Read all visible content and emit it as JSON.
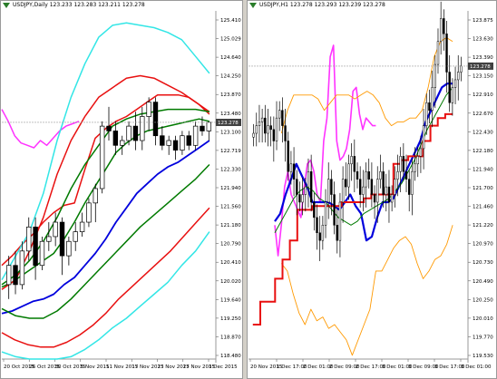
{
  "left_chart": {
    "title": "USDJPY,Daily  123.233 123.283 123.211 123.278",
    "price_label": "123.278",
    "y_ticks": [
      "125.410",
      "125.029",
      "124.640",
      "124.250",
      "123.870",
      "123.480",
      "123.100",
      "122.719",
      "122.330",
      "121.940",
      "121.560",
      "121.180",
      "120.790",
      "120.410",
      "120.020",
      "119.640",
      "119.250",
      "118.870",
      "118.480"
    ],
    "x_ticks": [
      "20 Oct 2015",
      "26 Oct 2015",
      "30 Oct 2015",
      "5 Nov 2015",
      "11 Nov 2015",
      "17 Nov 2015",
      "23 Nov 2015",
      "27 Nov 2015",
      "3 Dec 2015"
    ],
    "colors": {
      "candle": "#000000",
      "magenta": "#ff33ff",
      "red": "#e81010",
      "green": "#007a00",
      "blue": "#0000dd",
      "cyan": "#33e6e6",
      "gridline": "#c0c0c0"
    },
    "chart_data": {
      "type": "candlestick",
      "ylim": [
        118.35,
        125.6
      ],
      "candles": [
        [
          119.9,
          120.5,
          119.6,
          120.3
        ],
        [
          120.3,
          120.6,
          119.7,
          119.9
        ],
        [
          119.9,
          120.8,
          119.8,
          120.6
        ],
        [
          120.6,
          121.3,
          120.4,
          121.1
        ],
        [
          121.1,
          121.3,
          120.0,
          120.3
        ],
        [
          120.3,
          120.9,
          120.2,
          120.8
        ],
        [
          120.8,
          121.2,
          120.6,
          120.9
        ],
        [
          120.9,
          121.4,
          120.7,
          121.2
        ],
        [
          121.2,
          121.3,
          120.1,
          120.5
        ],
        [
          120.5,
          120.9,
          120.3,
          120.8
        ],
        [
          120.8,
          121.2,
          120.6,
          121.0
        ],
        [
          121.0,
          121.4,
          120.9,
          121.2
        ],
        [
          121.2,
          121.7,
          121.1,
          121.6
        ],
        [
          121.6,
          122.0,
          121.2,
          121.9
        ],
        [
          121.9,
          123.3,
          121.8,
          123.2
        ],
        [
          123.2,
          123.6,
          122.9,
          123.1
        ],
        [
          123.1,
          123.3,
          122.6,
          122.8
        ],
        [
          122.8,
          123.0,
          122.6,
          122.9
        ],
        [
          122.9,
          123.3,
          122.8,
          123.2
        ],
        [
          123.2,
          123.5,
          122.7,
          122.9
        ],
        [
          122.9,
          123.6,
          122.7,
          123.4
        ],
        [
          123.4,
          123.8,
          123.1,
          123.7
        ],
        [
          123.7,
          123.8,
          122.8,
          123.0
        ],
        [
          123.0,
          123.2,
          122.7,
          122.8
        ],
        [
          122.8,
          123.0,
          122.6,
          122.9
        ],
        [
          122.9,
          123.0,
          122.5,
          122.7
        ],
        [
          122.7,
          123.1,
          122.6,
          123.0
        ],
        [
          123.0,
          123.1,
          122.7,
          122.8
        ],
        [
          122.8,
          123.3,
          122.7,
          123.2
        ],
        [
          123.2,
          123.4,
          123.0,
          123.1
        ],
        [
          123.1,
          123.3,
          122.9,
          123.28
        ]
      ],
      "series": {
        "magenta": [
          123.55,
          123.3,
          123.0,
          122.85,
          122.8,
          122.75,
          122.9,
          122.8,
          122.95,
          123.1,
          123.2,
          123.25,
          123.3
        ],
        "red_mid": [
          120.3,
          120.5,
          120.75,
          120.95,
          121.2,
          121.4,
          121.55,
          121.6,
          122.3,
          122.95,
          123.15,
          123.3,
          123.4,
          123.55,
          123.7,
          123.85,
          123.85,
          123.85,
          123.8,
          123.65,
          123.45
        ],
        "green_mid": [
          119.85,
          119.95,
          120.1,
          120.25,
          120.4,
          120.55,
          120.85,
          121.2,
          121.6,
          121.95,
          122.3,
          122.65,
          122.85,
          123.0,
          123.1,
          123.15,
          123.2,
          123.25,
          123.3,
          123.35,
          123.3
        ],
        "blue": [
          119.3,
          119.35,
          119.45,
          119.55,
          119.6,
          119.7,
          119.9,
          120.05,
          120.3,
          120.55,
          120.85,
          121.2,
          121.5,
          121.8,
          122.0,
          122.2,
          122.35,
          122.45,
          122.6,
          122.75,
          122.9
        ],
        "green_low": [
          119.4,
          119.25,
          119.2,
          119.2,
          119.35,
          119.6,
          119.9,
          120.2,
          120.5,
          120.8,
          121.1,
          121.35,
          121.6,
          121.85,
          122.1,
          122.4
        ],
        "red_low": [
          118.9,
          118.75,
          118.65,
          118.6,
          118.6,
          118.7,
          118.85,
          119.05,
          119.3,
          119.6,
          119.85,
          120.1,
          120.35,
          120.6,
          120.9,
          121.2,
          121.5
        ],
        "cyan_low": [
          118.5,
          118.4,
          118.35,
          118.35,
          118.35,
          118.4,
          118.55,
          118.75,
          119.0,
          119.2,
          119.45,
          119.7,
          119.95,
          120.3,
          120.6,
          121.0
        ],
        "cyan_up": [
          120.0,
          120.5,
          121.0,
          121.8,
          122.9,
          123.8,
          124.5,
          125.05,
          125.3,
          125.35,
          125.3,
          125.25,
          125.15,
          125.0,
          124.65,
          124.3
        ],
        "red_up": [
          119.8,
          120.0,
          120.6,
          121.3,
          122.2,
          122.9,
          123.4,
          123.8,
          124.0,
          124.2,
          124.25,
          124.2,
          124.05,
          123.9,
          123.7,
          123.5
        ],
        "green_up": [
          119.9,
          120.1,
          120.4,
          120.8,
          121.3,
          121.9,
          122.4,
          122.8,
          123.2,
          123.35,
          123.45,
          123.5,
          123.55,
          123.55,
          123.55,
          123.5
        ]
      }
    }
  },
  "right_chart": {
    "title": "USDJPY,H1  123.278 123.293 123.239 123.278",
    "price_label": "123.278",
    "y_ticks": [
      "123.875",
      "123.630",
      "123.390",
      "123.150",
      "122.910",
      "122.670",
      "122.430",
      "122.180",
      "121.940",
      "121.700",
      "121.460",
      "121.220",
      "120.970",
      "120.730",
      "120.490",
      "120.250",
      "120.010",
      "119.770",
      "119.530"
    ],
    "x_ticks": [
      "20 Nov 2015",
      "1 Dec 17:00",
      "2 Dec 01:00",
      "2 Dec 09:00",
      "2 Dec 17:00",
      "3 Dec 01:00",
      "3 Dec 09:00",
      "3 Dec 17:00",
      "3 Dec 01:00"
    ],
    "colors": {
      "candle": "#000000",
      "magenta": "#ff33ff",
      "red": "#e81010",
      "green": "#007a00",
      "blue": "#0000dd",
      "orange": "#ff9900",
      "gridline": "#c0c0c0"
    },
    "chart_data": {
      "type": "candlestick",
      "ylim": [
        119.45,
        124.0
      ],
      "candle_closes": [
        122.4,
        122.5,
        122.55,
        122.6,
        122.4,
        122.5,
        122.45,
        122.3,
        122.6,
        122.7,
        122.5,
        122.3,
        121.9,
        122.0,
        121.8,
        121.6,
        121.5,
        121.6,
        121.7,
        121.9,
        121.5,
        121.3,
        121.1,
        121.0,
        121.2,
        121.5,
        121.8,
        121.6,
        121.2,
        121.0,
        121.5,
        121.8,
        121.7,
        122.0,
        122.1,
        121.9,
        121.8,
        121.6,
        121.7,
        121.9,
        121.8,
        121.6,
        121.5,
        121.8,
        121.9,
        121.6,
        121.7,
        121.5,
        121.6,
        121.8,
        121.9,
        122.1,
        121.9,
        121.8,
        121.6,
        121.9,
        122.0,
        122.1,
        122.2,
        122.5,
        122.8,
        122.7,
        123.0,
        123.3,
        123.6,
        123.9,
        123.7,
        123.2,
        122.8,
        123.0,
        123.1,
        123.2,
        123.28
      ],
      "series": {
        "magenta": [
          121.2,
          120.8,
          121.2,
          121.7,
          121.9,
          121.6,
          121.5,
          121.4,
          121.3,
          121.7,
          122.0,
          122.05,
          121.9,
          121.6,
          121.5,
          122.3,
          122.6,
          123.4,
          123.55,
          122.3,
          122.05,
          122.1,
          122.2,
          122.45,
          122.95,
          123.0,
          122.65,
          122.45,
          122.6,
          122.55,
          122.5,
          122.5
        ],
        "orange_upper": [
          122.4,
          122.7,
          122.9,
          122.9,
          122.9,
          122.9,
          122.85,
          122.7,
          122.8,
          122.9,
          122.9,
          122.9,
          122.85,
          122.9,
          122.95,
          122.9,
          122.8,
          122.6,
          122.5,
          122.55,
          122.55,
          122.6,
          122.6,
          122.7,
          123.0,
          123.4,
          123.6,
          123.65,
          123.6
        ],
        "orange_lower": [
          120.7,
          120.6,
          120.3,
          120.05,
          119.9,
          120.1,
          119.95,
          120.0,
          119.85,
          119.9,
          119.8,
          119.7,
          119.5,
          119.7,
          119.9,
          120.1,
          120.6,
          120.6,
          120.75,
          120.9,
          121.0,
          121.05,
          120.95,
          120.7,
          120.5,
          120.6,
          120.75,
          120.8,
          120.95,
          121.2
        ],
        "blue": [
          121.25,
          121.35,
          121.6,
          121.8,
          122.0,
          121.85,
          121.7,
          121.5,
          121.5,
          121.5,
          121.5,
          121.45,
          121.4,
          121.5,
          121.6,
          121.45,
          121.35,
          121.0,
          121.05,
          121.3,
          121.5,
          121.5,
          121.55,
          121.7,
          121.85,
          122.0,
          122.15,
          122.3,
          122.55,
          122.7,
          122.85,
          123.0,
          123.05,
          123.05
        ],
        "green": [
          121.1,
          121.25,
          121.4,
          121.55,
          121.65,
          121.7,
          121.65,
          121.55,
          121.5,
          121.4,
          121.3,
          121.25,
          121.2,
          121.25,
          121.35,
          121.4,
          121.45,
          121.5,
          121.55,
          121.65,
          121.75,
          121.9,
          122.05,
          122.25,
          122.45,
          122.6,
          122.75,
          122.9,
          123.0
        ],
        "red_step": [
          119.9,
          120.2,
          120.2,
          120.5,
          120.75,
          121.0,
          121.4,
          121.4,
          121.45,
          121.45,
          121.45,
          121.45,
          121.5,
          121.5,
          121.5,
          121.55,
          121.6,
          121.6,
          121.6,
          122.0,
          122.05,
          122.1,
          122.1,
          122.3,
          122.5,
          122.6,
          122.65,
          122.65
        ]
      }
    }
  }
}
